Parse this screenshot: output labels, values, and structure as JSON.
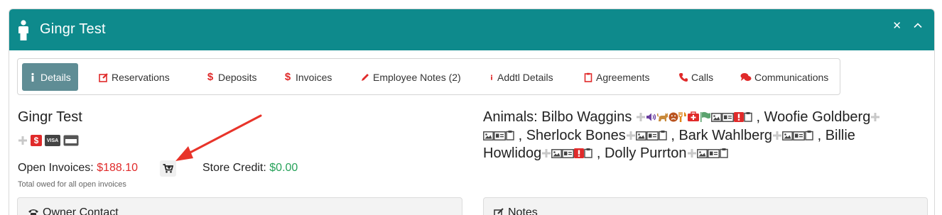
{
  "panel": {
    "title": "Gingr Test",
    "header_color": "#0e8a8c",
    "icons": [
      "person-icon",
      "close-icon",
      "chevron-up-icon"
    ],
    "close_glyph": "✕"
  },
  "tabs": [
    {
      "label": "Details",
      "icon": "info-icon",
      "active": true
    },
    {
      "label": "Reservations",
      "icon": "edit-icon",
      "active": false
    },
    {
      "label": "Deposits",
      "icon": "dollar-icon",
      "active": false
    },
    {
      "label": "Invoices",
      "icon": "dollar-icon",
      "active": false
    },
    {
      "label": "Employee Notes (2)",
      "icon": "pencil-icon",
      "active": false
    },
    {
      "label": "Addtl Details",
      "icon": "info-icon",
      "active": false
    },
    {
      "label": "Agreements",
      "icon": "clipboard-icon",
      "active": false
    },
    {
      "label": "Calls",
      "icon": "phone-icon",
      "active": false
    },
    {
      "label": "Communications",
      "icon": "chat-icon",
      "active": false
    }
  ],
  "owner": {
    "name": "Gingr Test",
    "payment_icons": [
      "plus-icon",
      "dollar-badge-icon",
      "visa-icon",
      "credit-card-icon"
    ],
    "visa_text": "VISA",
    "dollar_text": "$",
    "open_invoices_label": "Open Invoices:",
    "open_invoices_amount": "$188.10",
    "store_credit_label": "Store Credit:",
    "store_credit_amount": "$0.00",
    "owed_note": "Total owed for all open invoices"
  },
  "animals": {
    "label": "Animals:",
    "list": [
      {
        "name": "Bilbo Waggins",
        "icons": [
          "plus-icon",
          "volume-icon",
          "cat-icon",
          "frown-icon",
          "utensils-icon",
          "medkit-icon",
          "flag-icon",
          "image-icon",
          "id-card-icon",
          "alert-icon",
          "clipboard-icon"
        ]
      },
      {
        "name": "Woofie Goldberg",
        "icons": [
          "plus-icon",
          "image-icon",
          "id-card-icon",
          "clipboard-icon"
        ]
      },
      {
        "name": "Sherlock Bones",
        "icons": [
          "plus-icon",
          "image-icon",
          "id-card-icon",
          "clipboard-icon"
        ]
      },
      {
        "name": "Bark Wahlberg",
        "icons": [
          "plus-icon",
          "image-icon",
          "id-card-icon",
          "clipboard-icon"
        ]
      },
      {
        "name": "Billie Howlidog",
        "icons": [
          "plus-icon",
          "image-icon",
          "id-card-icon",
          "alert-icon",
          "clipboard-icon"
        ]
      },
      {
        "name": "Dolly Purrton",
        "icons": [
          "plus-icon",
          "image-icon",
          "id-card-icon",
          "clipboard-icon"
        ]
      }
    ],
    "separator": ","
  },
  "sections": {
    "owner_contact": "Owner Contact",
    "notes": "Notes"
  },
  "colors": {
    "accent": "#0e8a8c",
    "active_tab": "#5f8d95",
    "danger": "#e02a2a",
    "success": "#27a25a"
  }
}
